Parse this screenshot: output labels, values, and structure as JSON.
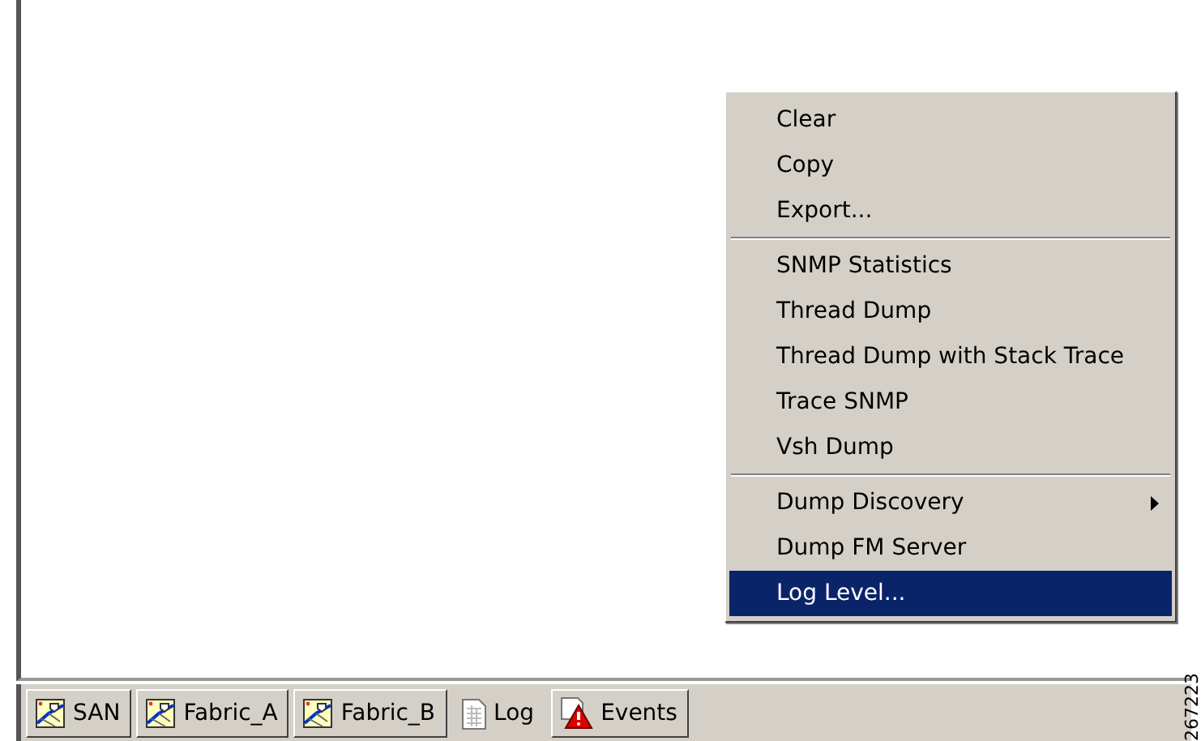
{
  "context_menu": {
    "groups": [
      [
        {
          "label": "Clear",
          "selected": false,
          "submenu": false
        },
        {
          "label": "Copy",
          "selected": false,
          "submenu": false
        },
        {
          "label": "Export...",
          "selected": false,
          "submenu": false
        }
      ],
      [
        {
          "label": "SNMP Statistics",
          "selected": false,
          "submenu": false
        },
        {
          "label": "Thread Dump",
          "selected": false,
          "submenu": false
        },
        {
          "label": "Thread Dump with Stack Trace",
          "selected": false,
          "submenu": false
        },
        {
          "label": "Trace SNMP",
          "selected": false,
          "submenu": false
        },
        {
          "label": "Vsh Dump",
          "selected": false,
          "submenu": false
        }
      ],
      [
        {
          "label": "Dump Discovery",
          "selected": false,
          "submenu": true
        },
        {
          "label": "Dump FM Server",
          "selected": false,
          "submenu": false
        },
        {
          "label": "Log Level...",
          "selected": true,
          "submenu": false
        }
      ]
    ]
  },
  "tabs": [
    {
      "label": "SAN",
      "kind": "fabric",
      "selected": false
    },
    {
      "label": "Fabric_A",
      "kind": "fabric",
      "selected": false
    },
    {
      "label": "Fabric_B",
      "kind": "fabric",
      "selected": false
    },
    {
      "label": "Log",
      "kind": "log",
      "selected": true
    },
    {
      "label": "Events",
      "kind": "events",
      "selected": false
    }
  ],
  "figure_id": "267223"
}
